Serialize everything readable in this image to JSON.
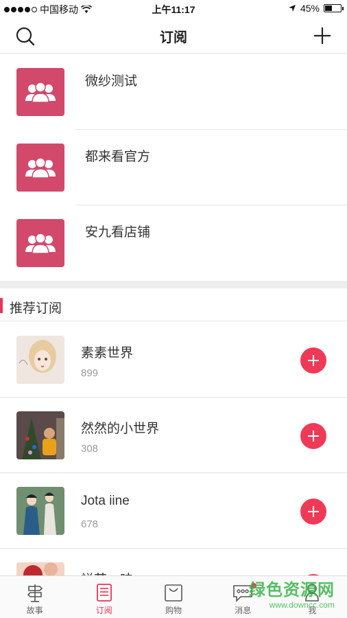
{
  "status_bar": {
    "carrier": "中国移动",
    "time": "上午11:17",
    "battery": "45%",
    "battery_level": 0.45
  },
  "nav": {
    "title": "订阅",
    "search_icon": "search-icon",
    "add_icon": "plus-icon"
  },
  "subscriptions": [
    {
      "name": "微纱测试"
    },
    {
      "name": "都来看官方"
    },
    {
      "name": "安九看店铺"
    }
  ],
  "recommend": {
    "title": "推荐订阅",
    "items": [
      {
        "name": "素素世界",
        "count": "899"
      },
      {
        "name": "然然的小世界",
        "count": "308"
      },
      {
        "name": "Jota iine",
        "count": "678"
      },
      {
        "name": "禅茶一味",
        "count": ""
      }
    ]
  },
  "tabs": [
    {
      "label": "故事",
      "icon": "signpost-icon",
      "active": false
    },
    {
      "label": "订阅",
      "icon": "list-icon",
      "active": true
    },
    {
      "label": "购物",
      "icon": "bag-icon",
      "active": false
    },
    {
      "label": "消息",
      "icon": "chat-icon",
      "active": false
    },
    {
      "label": "我",
      "icon": "person-icon",
      "active": false
    }
  ],
  "watermark": {
    "text": "绿色资源网",
    "url": "www.downcc.com"
  },
  "colors": {
    "accent": "#e8345a",
    "group_avatar": "#d2496c",
    "add_button": "#ef3a57"
  }
}
